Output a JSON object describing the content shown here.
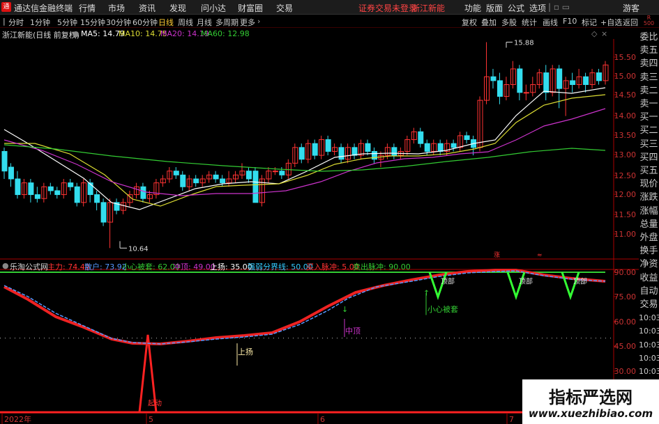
{
  "menubar": {
    "app_title": "通达信金融终端",
    "logo_char": "通",
    "items": [
      "行情",
      "市场",
      "资讯",
      "发现",
      "问小达",
      "财富圈",
      "交易"
    ],
    "login_notice": "证券交易未登录",
    "stock_name": "浙江新能",
    "right_items": [
      "功能",
      "版面",
      "公式",
      "选项"
    ],
    "guest": "游客"
  },
  "periodbar": {
    "periods": [
      "分时",
      "1分钟",
      "5分钟",
      "15分钟",
      "30分钟",
      "60分钟",
      "日线",
      "周线",
      "月线",
      "多周期",
      "更多"
    ],
    "active_period": "日线",
    "right_items": [
      "复权",
      "叠加",
      "多股",
      "统计",
      "画线",
      "F10",
      "标记",
      "+自选",
      "返回"
    ]
  },
  "infobar": {
    "title": "浙江新能(日线 前复权)",
    "ma5": "MA5: 14.79",
    "ma10": "MA10: 14.75",
    "ma20": "MA20: 14.19",
    "ma60": "MA60: 12.98"
  },
  "right_mode_labels": {
    "r": "R",
    "num": "500"
  },
  "right_panel": [
    "委比",
    "卖五",
    "卖四",
    "卖三",
    "卖二",
    "卖一",
    "买一",
    "买二",
    "买三",
    "买四",
    "买五",
    "现价",
    "涨跌",
    "涨幅",
    "总量",
    "外盘",
    "换手",
    "净资",
    "收益",
    "自动",
    "交易",
    "10:03",
    "10:03",
    "10:03",
    "10:03",
    "10:03",
    "10:03"
  ],
  "price_axis": [
    "15.50",
    "15.00",
    "14.50",
    "14.00",
    "13.50",
    "13.00",
    "12.50",
    "12.00",
    "11.50",
    "11.00"
  ],
  "annotations": {
    "high_label": "15.88",
    "low_label": "10.64",
    "zhang_label": "涨"
  },
  "indicator": {
    "name": "乐淘公式网",
    "items": [
      {
        "label": "主力: 74.49",
        "color": "#ff3333"
      },
      {
        "label": "散户: 73.92",
        "color": "#5599ff"
      },
      {
        "label": "小心被套: 62.00",
        "color": "#33cc33"
      },
      {
        "label": "冲顶: 49.00",
        "color": "#cc33cc"
      },
      {
        "label": "上扬: 35.00",
        "color": "#ffffff"
      },
      {
        "label": "强弱分界线: 50.00",
        "color": "#33ccff"
      },
      {
        "label": "买入脉冲: 5.00",
        "color": "#ff3333"
      },
      {
        "label": "卖出脉冲: 90.00",
        "color": "#33cc33"
      }
    ],
    "axis": [
      "90.00",
      "75.00",
      "60.00",
      "45.00",
      "30.00"
    ],
    "signal_labels": {
      "shangyang": "上扬",
      "chongding": "中顶",
      "xiaoxin": "小心被套",
      "qidong": "起动",
      "dingbu": "顶部"
    }
  },
  "date_axis": [
    "2022年",
    "5",
    "6",
    "7"
  ],
  "watermark": {
    "title": "指标严选网",
    "url": "www.xuezhibiao.com"
  },
  "colors": {
    "up": "#ff3333",
    "down": "#33ddee",
    "ma5": "#ffffff",
    "ma10": "#dddd33",
    "ma20": "#cc33cc",
    "ma60": "#33cc33",
    "grid": "#5a0000"
  }
}
